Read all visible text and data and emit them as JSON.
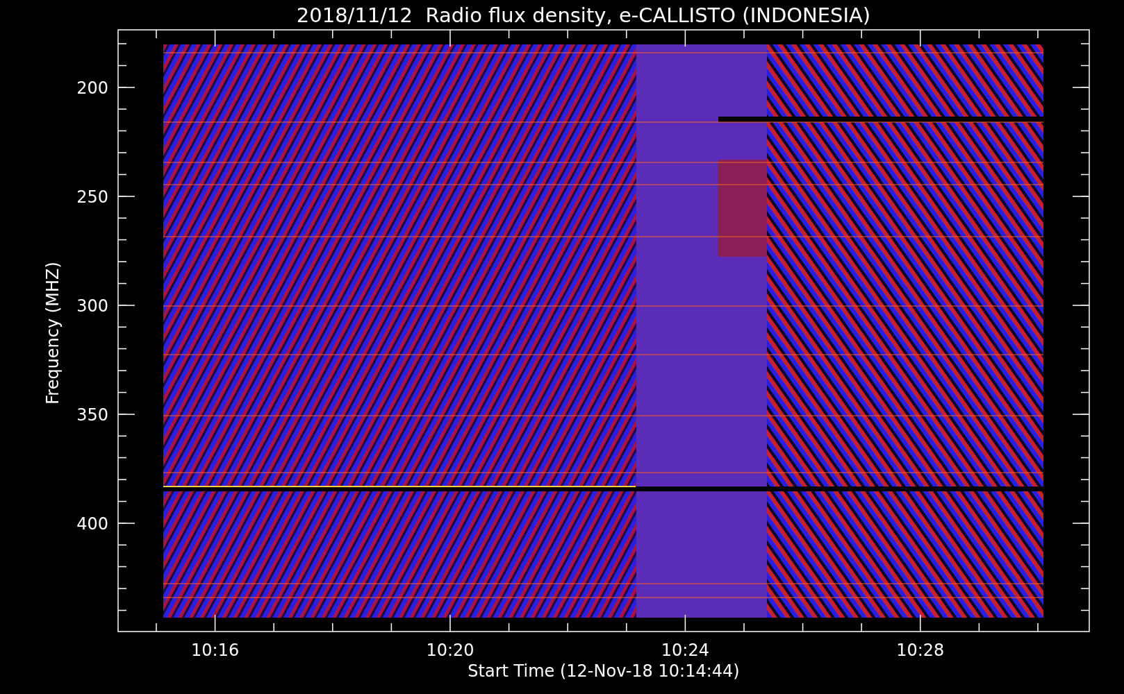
{
  "title": "2018/11/12  Radio flux density, e-CALLISTO (INDONESIA)",
  "y_axis": {
    "label": "Frequency (MHZ)",
    "ticks": [
      "200",
      "250",
      "300",
      "350",
      "400"
    ]
  },
  "x_axis": {
    "label": "Start Time (12-Nov-18 10:14:44)",
    "ticks": [
      "10:16",
      "10:20",
      "10:24",
      "10:28"
    ]
  }
}
